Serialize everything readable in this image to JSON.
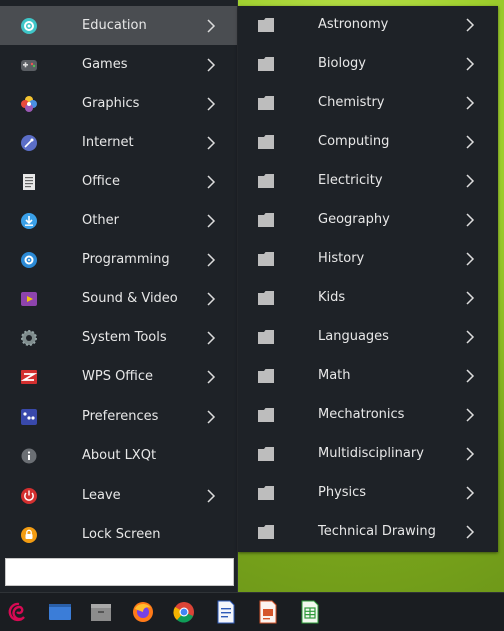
{
  "main_menu": {
    "items": [
      {
        "label": "Education",
        "icon": "education-icon",
        "has_submenu": true
      },
      {
        "label": "Games",
        "icon": "gamepad-icon",
        "has_submenu": true
      },
      {
        "label": "Graphics",
        "icon": "graphics-icon",
        "has_submenu": true
      },
      {
        "label": "Internet",
        "icon": "internet-icon",
        "has_submenu": true
      },
      {
        "label": "Office",
        "icon": "document-icon",
        "has_submenu": true
      },
      {
        "label": "Other",
        "icon": "other-icon",
        "has_submenu": true
      },
      {
        "label": "Programming",
        "icon": "programming-icon",
        "has_submenu": true
      },
      {
        "label": "Sound & Video",
        "icon": "multimedia-icon",
        "has_submenu": true
      },
      {
        "label": "System Tools",
        "icon": "system-gear-icon",
        "has_submenu": true
      },
      {
        "label": "WPS Office",
        "icon": "wps-office-icon",
        "has_submenu": true
      },
      {
        "label": "Preferences",
        "icon": "preferences-icon",
        "has_submenu": true
      },
      {
        "label": "About LXQt",
        "icon": "info-icon",
        "has_submenu": false
      },
      {
        "label": "Leave",
        "icon": "power-icon",
        "has_submenu": true
      },
      {
        "label": "Lock Screen",
        "icon": "lock-icon",
        "has_submenu": false
      }
    ],
    "active_item": "Education"
  },
  "search": {
    "value": ""
  },
  "submenu": {
    "items": [
      {
        "label": "Astronomy"
      },
      {
        "label": "Biology"
      },
      {
        "label": "Chemistry"
      },
      {
        "label": "Computing"
      },
      {
        "label": "Electricity"
      },
      {
        "label": "Geography"
      },
      {
        "label": "History"
      },
      {
        "label": "Kids"
      },
      {
        "label": "Languages"
      },
      {
        "label": "Math"
      },
      {
        "label": "Mechatronics"
      },
      {
        "label": "Multidisciplinary"
      },
      {
        "label": "Physics"
      },
      {
        "label": "Technical Drawing"
      }
    ]
  },
  "taskbar": {
    "buttons": [
      "debian-menu-icon",
      "desktop-icon",
      "file-manager-icon",
      "firefox-icon",
      "chrome-icon",
      "wps-writer-icon",
      "wps-presentation-icon",
      "wps-spreadsheet-icon"
    ]
  },
  "colors": {
    "menu_bg": "#1e2227",
    "active_bg": "#4a4d51",
    "text": "#e8e8e8",
    "folder": "#bdbdbd"
  }
}
